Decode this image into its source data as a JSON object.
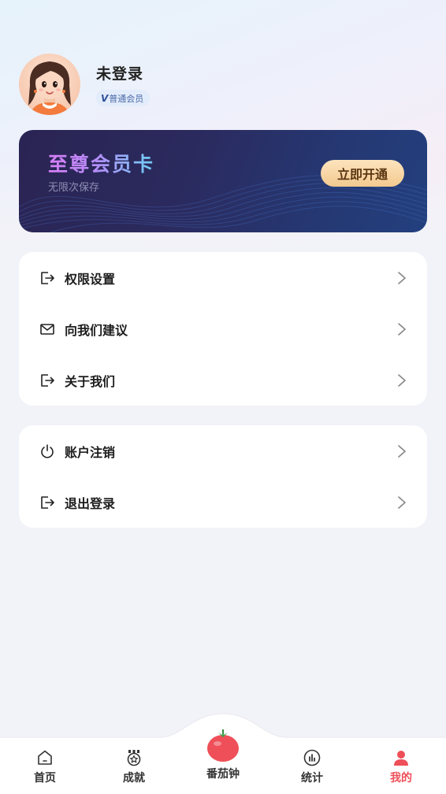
{
  "profile": {
    "name": "未登录",
    "badge_mark": "V",
    "badge_label": "普通会员"
  },
  "vip_card": {
    "title": "至尊会员卡",
    "subtitle": "无限次保存",
    "button_label": "立即开通"
  },
  "menu_group_1": [
    {
      "label": "权限设置",
      "icon": "logout-arrow-icon"
    },
    {
      "label": "向我们建议",
      "icon": "mail-icon"
    },
    {
      "label": "关于我们",
      "icon": "logout-arrow-icon"
    }
  ],
  "menu_group_2": [
    {
      "label": "账户注销",
      "icon": "power-icon"
    },
    {
      "label": "退出登录",
      "icon": "logout-arrow-icon"
    }
  ],
  "tabbar": {
    "items": [
      {
        "label": "首页",
        "icon": "home-icon"
      },
      {
        "label": "成就",
        "icon": "medal-icon"
      },
      {
        "label": "番茄钟",
        "icon": "tomato-icon"
      },
      {
        "label": "统计",
        "icon": "stats-icon"
      },
      {
        "label": "我的",
        "icon": "user-icon"
      }
    ],
    "active_index": 4
  },
  "colors": {
    "accent": "#ee4f58",
    "vip_button": "#f3c98f",
    "badge_bg": "#e3ecfb"
  }
}
